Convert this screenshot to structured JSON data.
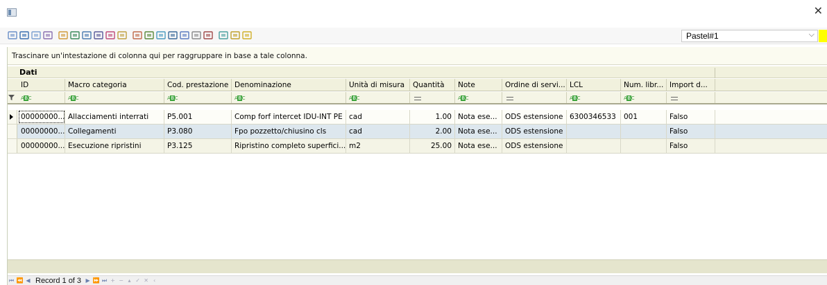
{
  "window": {
    "app_icon": "window-icon",
    "close_icon": "close-icon"
  },
  "toolbar": {
    "icons": [
      "grid-tool-icon",
      "search-icon",
      "zoom-icon",
      "layout-icon",
      "align-icon",
      "sort-icon",
      "table-icon",
      "grid-icon",
      "columns-icon",
      "link-icon",
      "link-alt-icon",
      "palette-icon",
      "form-icon",
      "form-alt-icon",
      "filter-icon",
      "chart-icon",
      "barcode-icon",
      "export-icon",
      "help-icon",
      "info-icon"
    ],
    "theme_value": "Pastel#1"
  },
  "grid": {
    "group_hint": "Trascinare un'intestazione di colonna qui per raggruppare in base a tale colonna.",
    "band_title": "Dati",
    "columns": [
      {
        "label": "ID",
        "filter": "abc"
      },
      {
        "label": "Macro categoria",
        "filter": "abc"
      },
      {
        "label": "Cod. prestazione",
        "filter": "abc"
      },
      {
        "label": "Denominazione",
        "filter": "abc"
      },
      {
        "label": "Unità di misura",
        "filter": "abc"
      },
      {
        "label": "Quantità",
        "filter": "eq"
      },
      {
        "label": "Note",
        "filter": "abc"
      },
      {
        "label": "Ordine di servi...",
        "filter": "eq"
      },
      {
        "label": "LCL",
        "filter": "abc"
      },
      {
        "label": "Num. libr...",
        "filter": "abc"
      },
      {
        "label": "Import d...",
        "filter": "eq"
      }
    ],
    "rows": [
      [
        "00000000...",
        "Allacciamenti interrati",
        "P5.001",
        "Comp forf intercet IDU-INT PE",
        "cad",
        "1.00",
        "Nota ese...",
        "ODS estensione",
        "6300346533",
        "001",
        "Falso"
      ],
      [
        "00000000...",
        "Collegamenti",
        "P3.080",
        "Fpo pozzetto/chiusino cls",
        "cad",
        "2.00",
        "Nota ese...",
        "ODS estensione",
        "",
        "",
        "Falso"
      ],
      [
        "00000000...",
        "Esecuzione ripristini",
        "P3.125",
        "Ripristino completo superfici...",
        "m2",
        "25.00",
        "Nota ese...",
        "ODS estensione",
        "",
        "",
        "Falso"
      ]
    ]
  },
  "navigator": {
    "record_text": "Record 1 of 3"
  }
}
